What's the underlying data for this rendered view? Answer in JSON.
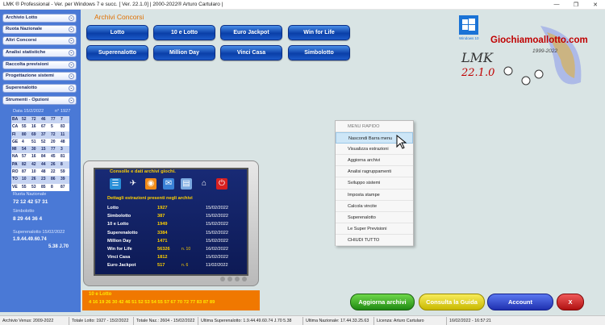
{
  "window": {
    "title": "LMK ® Professional - Ver. per Windows 7 e succ. [ Ver. 22.1.0] | 2000-2022® Arturo Cartularo |",
    "controls": [
      "—",
      "❐",
      "✕"
    ]
  },
  "sidebar": {
    "items": [
      {
        "label": "Archivio Lotto"
      },
      {
        "label": "Ruota Nazionale"
      },
      {
        "label": "Altri Concorsi"
      },
      {
        "label": "Analisi statistiche"
      },
      {
        "label": "Raccolta previsioni"
      },
      {
        "label": "Progettazione sistemi"
      },
      {
        "label": "Superenalotto"
      },
      {
        "label": "Strumenti - Opzioni"
      }
    ],
    "chevron": "⌄",
    "draw_date": "Data 15/2/2022",
    "draw_number": "n° 1927",
    "lotto_table": [
      [
        "BA",
        "52",
        "72",
        "46",
        "77",
        "7"
      ],
      [
        "CA",
        "55",
        "16",
        "67",
        "5",
        "83"
      ],
      [
        "FI",
        "80",
        "69",
        "37",
        "72",
        "11"
      ],
      [
        "GE",
        "4",
        "51",
        "52",
        "20",
        "48"
      ],
      [
        "MI",
        "54",
        "30",
        "15",
        "77",
        "3"
      ],
      [
        "NA",
        "57",
        "16",
        "84",
        "45",
        "81"
      ],
      [
        "PA",
        "82",
        "42",
        "44",
        "26",
        "8"
      ],
      [
        "RO",
        "87",
        "10",
        "48",
        "22",
        "59"
      ],
      [
        "TO",
        "10",
        "26",
        "23",
        "86",
        "39"
      ],
      [
        "VE",
        "55",
        "53",
        "85",
        "8",
        "87"
      ]
    ],
    "ruota_nazionale_label": "Ruota Nazionale",
    "ruota_nazionale_numbers": "72 12 42 57 31",
    "simbolotto_label": "Simbolotto",
    "simbolotto_numbers": "8  29  44  36  4",
    "superenalotto_label": "Superenalotto  15/02/2022",
    "superenalotto_numbers": "1.9.44.49.60.74",
    "superenalotto_extra": "5.38   J.70"
  },
  "main": {
    "heading": "Archivi Concorsi",
    "buttons": [
      {
        "label": "Lotto"
      },
      {
        "label": "10 e Lotto"
      },
      {
        "label": "Euro Jackpot"
      },
      {
        "label": "Win for Life"
      },
      {
        "label": "Superenalotto"
      },
      {
        "label": "Million Day"
      },
      {
        "label": "Vinci Casa"
      },
      {
        "label": "Simbolotto"
      }
    ]
  },
  "logo": {
    "site": "Giochiamoallotto.com",
    "years": "1999-2022",
    "brand": "LMK",
    "version": "22.1.0",
    "windows_badge": "Windows 10",
    "lettering": [
      "LMK",
      "22.1.0"
    ]
  },
  "context_menu": {
    "header": "MENU RAPIDO",
    "items": [
      {
        "label": "Nascondi Barra menu",
        "selected": true
      },
      {
        "label": "Visualizza estrazioni"
      },
      {
        "label": "Aggiorna archivi"
      },
      {
        "label": "Analisi ragruppamenti"
      },
      {
        "label": "Sviluppo sistemi"
      },
      {
        "label": "Imposta stampe"
      },
      {
        "label": "Calcola vincite"
      },
      {
        "label": "Superenalotto"
      },
      {
        "label": "Le Super Previsioni"
      },
      {
        "label": "CHIUDI TUTTO"
      }
    ]
  },
  "tv_panel": {
    "title": "Consolle e dati archivi giochi.",
    "subtitle": "Dettagli estrazioni presenti negli archivi",
    "icons": [
      "list-icon",
      "satellite-icon",
      "rss-icon",
      "mail-icon",
      "book-icon",
      "home-icon",
      "power-icon"
    ],
    "rows": [
      {
        "name": "Lotto",
        "value": "1927",
        "extra": "",
        "date": "15/02/2022"
      },
      {
        "name": "Simbolotto",
        "value": "387",
        "extra": "",
        "date": "15/02/2022"
      },
      {
        "name": "10 e Lotto",
        "value": "1949",
        "extra": "",
        "date": "15/02/2022"
      },
      {
        "name": "Superenalotto",
        "value": "3384",
        "extra": "",
        "date": "15/02/2022"
      },
      {
        "name": "Million Day",
        "value": "1471",
        "extra": "",
        "date": "15/02/2022"
      },
      {
        "name": "Win for Life",
        "value": "56326",
        "extra": "n. 10",
        "date": "16/02/2022"
      },
      {
        "name": "Vinci Casa",
        "value": "1812",
        "extra": "",
        "date": "15/02/2022"
      },
      {
        "name": "Euro Jackpot",
        "value": "517",
        "extra": "n. 6",
        "date": "11/02/2022"
      }
    ]
  },
  "lotto10": {
    "title": "10 e Lotto",
    "numbers": "4 16 19 26 30 42 46 51 52 53 54 55 57 67 70 72 77 83 87 89"
  },
  "bottom_buttons": {
    "update": "Aggiorna archivi",
    "guide": "Consulta la Guida",
    "account": "Account",
    "exit": "X"
  },
  "status_bar": [
    "Archivio Venus: 2009-2022",
    "Totale Lotto: 1927 - 15/2/2022",
    "Totale Naz.: 2604 - 15/02/2022",
    "Ultima Superenalotto: 1.9.44.49.60.74 J.70 5.38",
    "Ultima Nazionale: 17.44.33.25.63",
    "Licenza: Arturo Cartularo",
    "16/02/2022 - 16:57:21"
  ],
  "colors": {
    "sidebar": "#4a79d6",
    "accent_orange": "#f07800",
    "button_blue": "#0a3fa8",
    "update_green": "#2fa01e",
    "guide_yellow": "#d8c800",
    "account_blue": "#2f44c8",
    "exit_red": "#c81e1e"
  }
}
